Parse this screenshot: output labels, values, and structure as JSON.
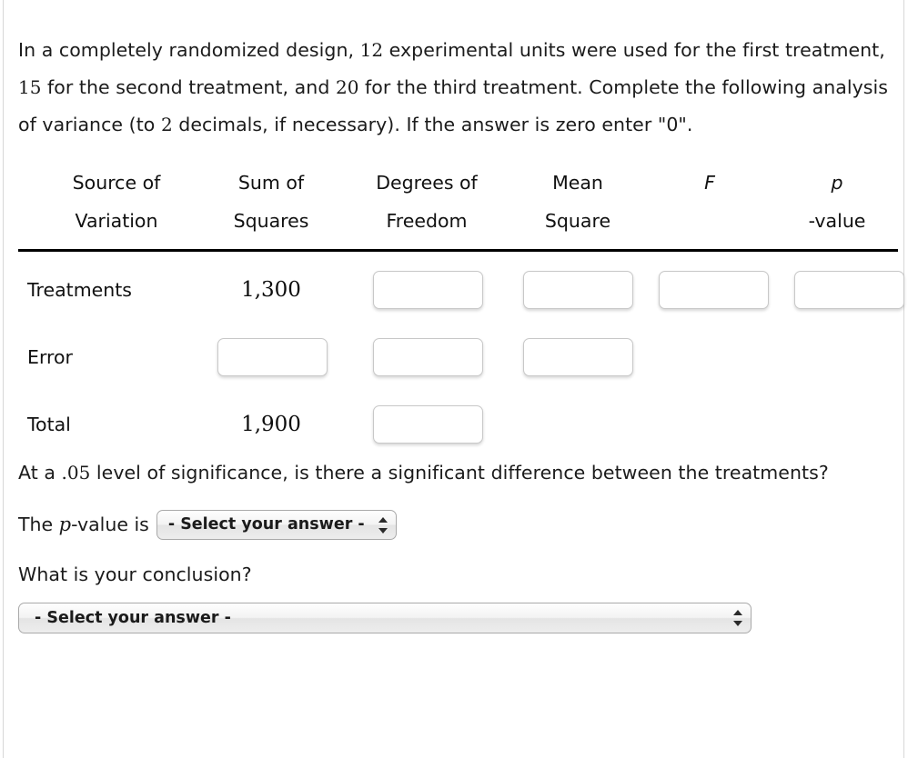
{
  "problem": {
    "line1_a": "In a completely randomized design, ",
    "n1": "12",
    "line1_b": " experimental units were used for the first treatment, ",
    "n2": "15",
    "line1_c": " for the second treatment, and ",
    "n3": "20",
    "line1_d": " for the third treatment. Complete the following analysis of variance (to ",
    "decimals": "2",
    "line1_e": " decimals, if necessary). If the answer is zero enter \"0\"."
  },
  "table": {
    "headers": [
      {
        "line1": "Source of",
        "line2": "Variation",
        "italic": false
      },
      {
        "line1": "Sum of",
        "line2": "Squares",
        "italic": false
      },
      {
        "line1": "Degrees of",
        "line2": "Freedom",
        "italic": false
      },
      {
        "line1": "Mean",
        "line2": "Square",
        "italic": false
      },
      {
        "line1": "F",
        "line2": "",
        "italic": true
      },
      {
        "line1": "p",
        "line2": "",
        "italic": true,
        "suffix": "-value"
      }
    ],
    "rows": [
      {
        "label": "Treatments",
        "sum_of_squares": "1,300",
        "sum_of_squares_is_input": false,
        "degrees_of_freedom": "",
        "mean_square": "",
        "f": "",
        "p_value": ""
      },
      {
        "label": "Error",
        "sum_of_squares": "",
        "sum_of_squares_is_input": true,
        "degrees_of_freedom": "",
        "mean_square": "",
        "f": null,
        "p_value": null
      },
      {
        "label": "Total",
        "sum_of_squares": "1,900",
        "sum_of_squares_is_input": false,
        "degrees_of_freedom": "",
        "mean_square": null,
        "f": null,
        "p_value": null
      }
    ]
  },
  "significance": {
    "text_a": "At a ",
    "level": ".05",
    "text_b": " level of significance, is there a significant difference between the treatments?"
  },
  "pvalue_question": {
    "prefix_a": "The ",
    "var": "p",
    "prefix_b": "-value is",
    "select_value": "- Select your answer -"
  },
  "conclusion_question": {
    "label": "What is your conclusion?",
    "select_value": "- Select your answer -"
  }
}
